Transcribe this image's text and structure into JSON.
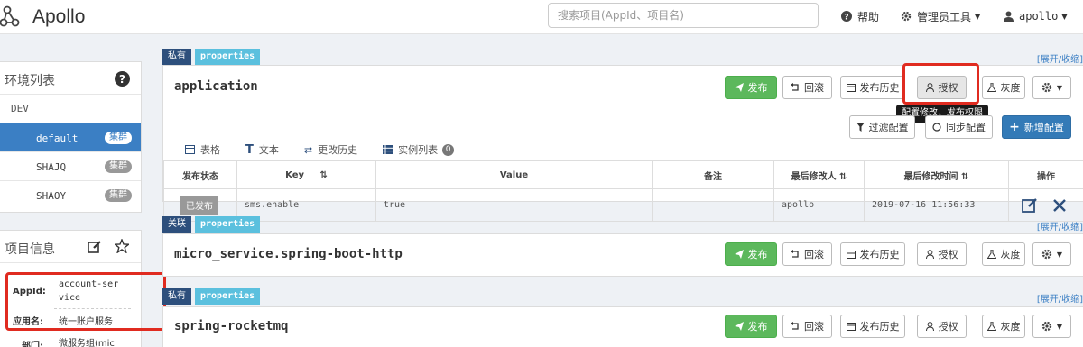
{
  "app": {
    "name": "Apollo"
  },
  "search": {
    "placeholder": "搜索项目(AppId、项目名)"
  },
  "nav": {
    "help": "帮助",
    "admin_tools": "管理员工具",
    "user": "apollo"
  },
  "env_panel": {
    "title": "环境列表",
    "env": "DEV",
    "clusters": [
      {
        "name": "default",
        "tag": "集群",
        "active": true
      },
      {
        "name": "SHAJQ",
        "tag": "集群",
        "active": false
      },
      {
        "name": "SHAOY",
        "tag": "集群",
        "active": false
      }
    ]
  },
  "project_panel": {
    "title": "项目信息",
    "appid_label": "AppId:",
    "appid_line1": "account-ser",
    "appid_line2": "vice",
    "appname_label": "应用名:",
    "appname_value": "统一账户服务",
    "dept_label": "部门:",
    "dept_value": "微服务组(mic"
  },
  "expand_label": "[展开/收缩]",
  "namespaces": [
    {
      "scope": "私有",
      "format": "properties",
      "name": "application",
      "buttons": {
        "publish": "发布",
        "rollback": "回滚",
        "history": "发布历史",
        "grant": "授权",
        "gray": "灰度"
      },
      "tooltip": "配置修改、发布权限",
      "tabs": {
        "table": "表格",
        "text": "文本",
        "history": "更改历史",
        "instances": "实例列表",
        "instance_count": "0"
      },
      "filter_label": "过滤配置",
      "sync_label": "同步配置",
      "add_label": "新增配置",
      "columns": [
        "发布状态",
        "Key",
        "Value",
        "备注",
        "最后修改人",
        "最后修改时间",
        "操作"
      ],
      "rows": [
        {
          "status": "已发布",
          "key": "sms.enable",
          "value": "true",
          "comment": "",
          "modifier": "apollo",
          "time": "2019-07-16 11:56:33"
        }
      ]
    },
    {
      "scope": "关联",
      "format": "properties",
      "name": "micro_service.spring-boot-http",
      "buttons": {
        "publish": "发布",
        "rollback": "回滚",
        "history": "发布历史",
        "grant": "授权",
        "gray": "灰度"
      }
    },
    {
      "scope": "私有",
      "format": "properties",
      "name": "spring-rocketmq",
      "buttons": {
        "publish": "发布",
        "rollback": "回滚",
        "history": "发布历史",
        "grant": "授权",
        "gray": "灰度"
      }
    }
  ],
  "colors": {
    "primary": "#3b7fc4",
    "success": "#5cb85c",
    "highlight_box": "#e02b20",
    "tag_dark": "#2d4f7c",
    "tag_light": "#5bc0de"
  }
}
